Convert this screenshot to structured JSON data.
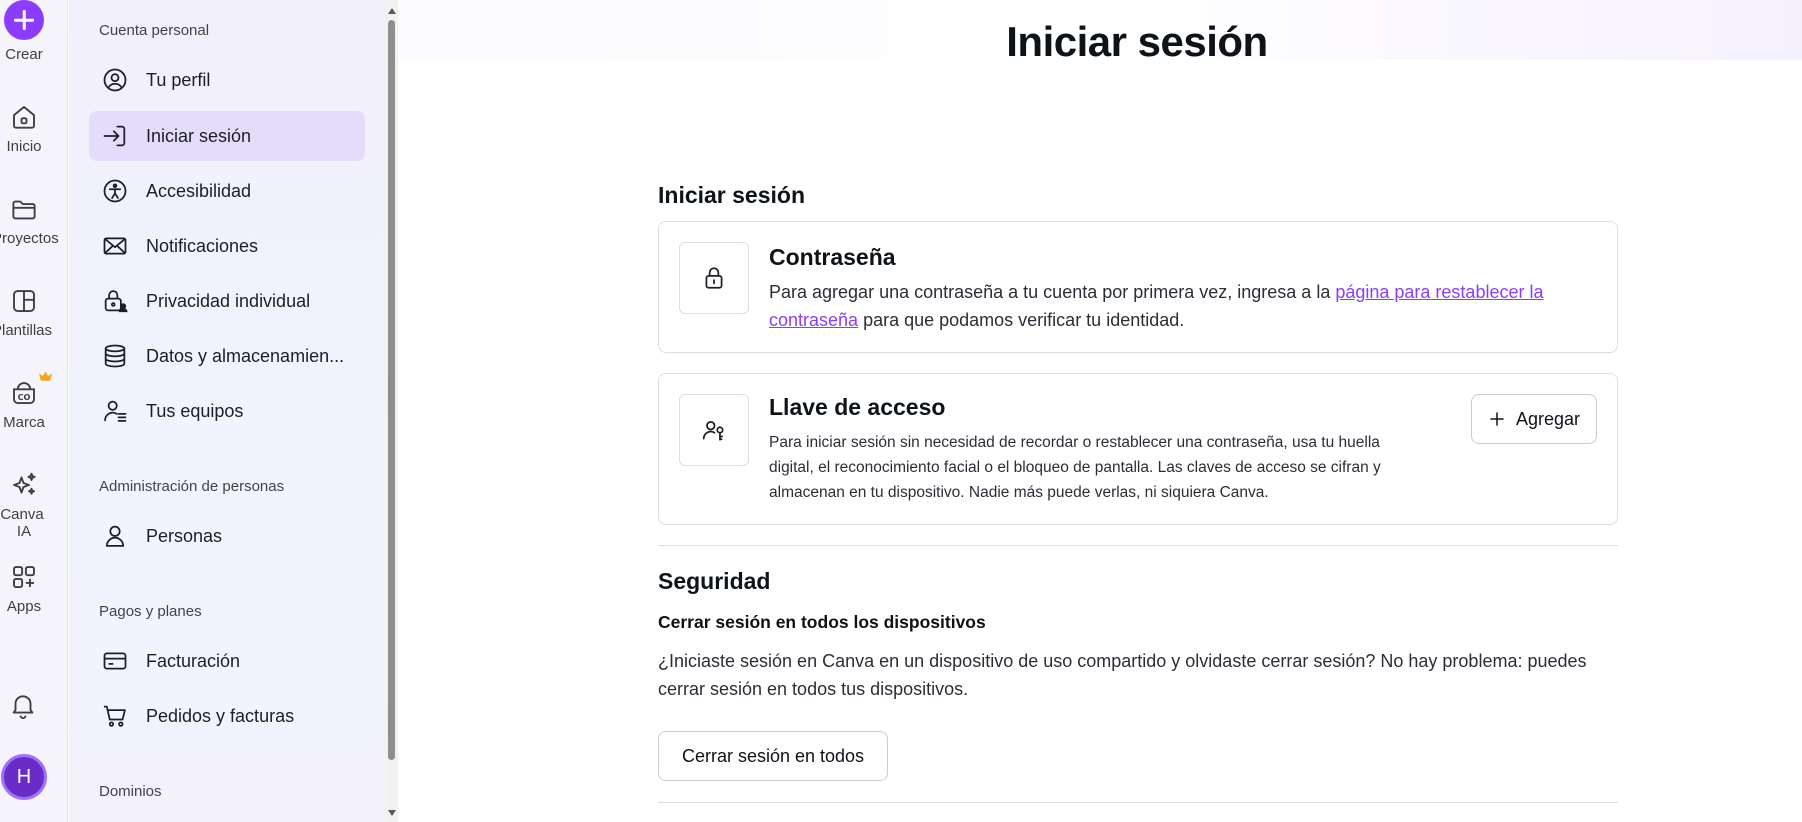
{
  "rail": {
    "create_label": "Crear",
    "items": [
      {
        "label": "Inicio",
        "icon": "home-icon"
      },
      {
        "label": "Proyectos",
        "icon": "folder-icon"
      },
      {
        "label": "Plantillas",
        "icon": "templates-icon"
      },
      {
        "label": "Marca",
        "icon": "brand-icon"
      },
      {
        "label": "Canva IA",
        "icon": "sparkles-icon"
      },
      {
        "label": "Apps",
        "icon": "apps-icon"
      }
    ],
    "avatar_initial": "H"
  },
  "sidebar": {
    "sections": [
      {
        "heading": "Cuenta personal",
        "items": [
          {
            "label": "Tu perfil",
            "icon": "profile-icon"
          },
          {
            "label": "Iniciar sesión",
            "icon": "login-icon"
          },
          {
            "label": "Accesibilidad",
            "icon": "accessibility-icon"
          },
          {
            "label": "Notificaciones",
            "icon": "mail-icon"
          },
          {
            "label": "Privacidad individual",
            "icon": "privacy-lock-icon"
          },
          {
            "label": "Datos y almacenamien...",
            "icon": "database-icon"
          },
          {
            "label": "Tus equipos",
            "icon": "teams-icon"
          }
        ]
      },
      {
        "heading": "Administración de personas",
        "items": [
          {
            "label": "Personas",
            "icon": "person-icon"
          }
        ]
      },
      {
        "heading": "Pagos y planes",
        "items": [
          {
            "label": "Facturación",
            "icon": "credit-card-icon"
          },
          {
            "label": "Pedidos y facturas",
            "icon": "cart-icon"
          }
        ]
      },
      {
        "heading": "Dominios",
        "items": []
      }
    ]
  },
  "main": {
    "title": "Iniciar sesión",
    "login_section": {
      "heading": "Iniciar sesión",
      "password_card": {
        "title": "Contraseña",
        "text_before": "Para agregar una contraseña a tu cuenta por primera vez, ingresa a la ",
        "link_line1": "página para restablecer la",
        "link_line2": "contraseña",
        "text_after": " para que podamos verificar tu identidad.",
        "icon": "lock-icon"
      },
      "passkey_card": {
        "title": "Llave de acceso",
        "text": "Para iniciar sesión sin necesidad de recordar o restablecer una contraseña, usa tu huella digital, el reconocimiento facial o el bloqueo de pantalla. Las claves de acceso se cifran y almacenan en tu dispositivo. Nadie más puede verlas, ni siquiera Canva.",
        "button_label": "Agregar",
        "icon": "passkey-icon"
      }
    },
    "security_section": {
      "heading": "Seguridad",
      "subheading": "Cerrar sesión en todos los dispositivos",
      "text": "¿Iniciaste sesión en Canva en un dispositivo de uso compartido y olvidaste cerrar sesión? No hay problema: puedes cerrar sesión en todos tus dispositivos.",
      "button_label": "Cerrar sesión en todos"
    }
  },
  "colors": {
    "accent": "#8b3dff",
    "active_bg": "#e5dcfb",
    "crown": "#f5a623"
  }
}
